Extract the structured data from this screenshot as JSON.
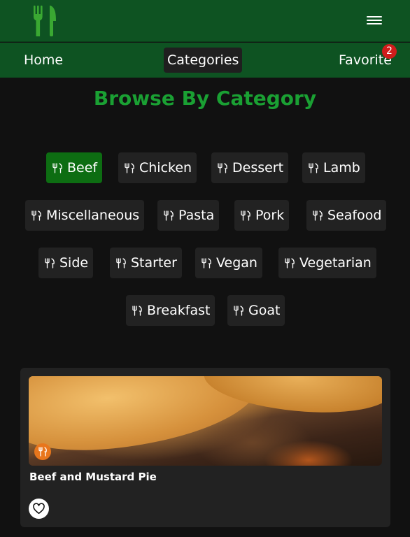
{
  "header": {
    "logo_icon": "fork-knife-icon",
    "menu_icon": "hamburger-menu-icon",
    "brand_color": "#0e5322"
  },
  "nav": {
    "home": "Home",
    "categories": "Categories",
    "favorite": "Favorite",
    "favorite_count": "2"
  },
  "heading": "Browse By Category",
  "categories": [
    {
      "label": "Beef",
      "active": true
    },
    {
      "label": "Chicken",
      "active": false
    },
    {
      "label": "Dessert",
      "active": false
    },
    {
      "label": "Lamb",
      "active": false
    },
    {
      "label": "Miscellaneous",
      "active": false
    },
    {
      "label": "Pasta",
      "active": false
    },
    {
      "label": "Pork",
      "active": false
    },
    {
      "label": "Seafood",
      "active": false
    },
    {
      "label": "Side",
      "active": false
    },
    {
      "label": "Starter",
      "active": false
    },
    {
      "label": "Vegan",
      "active": false
    },
    {
      "label": "Vegetarian",
      "active": false
    },
    {
      "label": "Breakfast",
      "active": false
    },
    {
      "label": "Goat",
      "active": false
    }
  ],
  "meals": [
    {
      "title": "Beef and Mustard Pie",
      "favorite_icon": "heart-outline-icon"
    }
  ],
  "colors": {
    "accent_green": "#1aa033",
    "active_chip": "#0d6d12",
    "badge_red": "#d01c1c",
    "meal_badge_orange": "#e8761c"
  }
}
